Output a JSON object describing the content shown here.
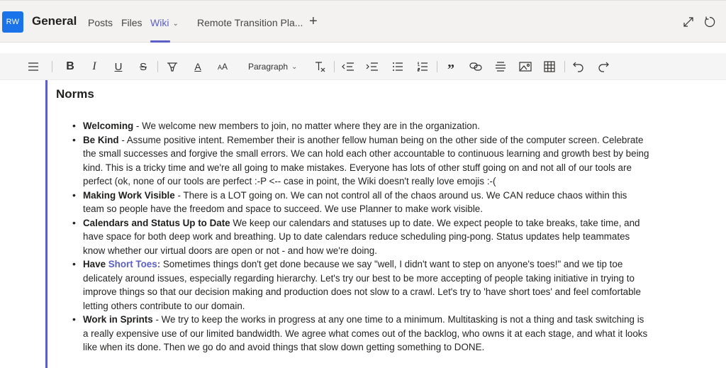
{
  "header": {
    "avatar_initials": "RW",
    "avatar_color": "#1a73e8",
    "channel_title": "General",
    "tabs": [
      {
        "label": "Posts",
        "active": false
      },
      {
        "label": "Files",
        "active": false
      },
      {
        "label": "Wiki",
        "active": true
      },
      {
        "label": "Remote Transition Pla...",
        "active": false
      }
    ],
    "add_tab_icon": "plus-icon",
    "expand_icon": "expand-icon",
    "refresh_icon": "refresh-icon",
    "accent_color": "#5b5fc7"
  },
  "toolbar": {
    "paragraph_style": "Paragraph",
    "buttons": [
      "menu",
      "bold",
      "italic",
      "underline",
      "strikethrough",
      "highlight",
      "font-color",
      "font-size",
      "clear-formatting",
      "decrease-indent",
      "increase-indent",
      "bulleted-list",
      "numbered-list",
      "quote",
      "link",
      "horizontal-rule",
      "image",
      "table",
      "undo",
      "redo"
    ]
  },
  "content": {
    "heading": "Norms",
    "items": [
      {
        "title": "Welcoming",
        "text": " - We welcome new members to join, no matter where they are in the organization."
      },
      {
        "title": "Be Kind",
        "text": " -  Assume positive intent. Remember their is another fellow human being on the other side of the computer screen. Celebrate the small successes and forgive the small errors. We can hold each other accountable to continuous learning and growth best by being kind. This is a tricky time and we're all going to make mistakes. Everyone has lots of other stuff going on and not all of our tools are perfect (ok, none of our tools are perfect :-P <-- case in point, the Wiki doesn't really love emojis :-("
      },
      {
        "title": "Making Work Visible",
        "text": " - There is a LOT going on. We can not control all of the chaos around us. We CAN reduce chaos within this team so people have the freedom and space to succeed. We use Planner to make work visible."
      },
      {
        "title": "Calendars and Status Up to Date",
        "text": " We keep our calendars and statuses up to date. We expect people to take breaks, take time, and have space for both deep work and breathing. Up to date calendars reduce scheduling ping-pong. Status updates help teammates know whether our virtual doors are open or not - and how we're doing."
      },
      {
        "title": "Have",
        "link": "Short Toes:",
        "text": " Sometimes things don't get done because we say \"well, I didn't want to step on anyone's toes!\" and we tip toe delicately around issues, especially regarding hierarchy. Let's try our best to be more accepting of people taking initiative in trying to improve things so that our decision making and production does not slow to a crawl. Let's try to 'have short toes' and feel comfortable letting others contribute to our domain."
      },
      {
        "title": "Work in Sprints",
        "text": " - We try to keep the works in progress at any one time to a minimum. Multitasking is not a thing and task switching is a really expensive use of our limited bandwidth. We agree what comes out of the backlog, who owns it at each stage, and what it looks like when its done. Then we go do and avoid things that slow down getting something to DONE."
      }
    ]
  }
}
